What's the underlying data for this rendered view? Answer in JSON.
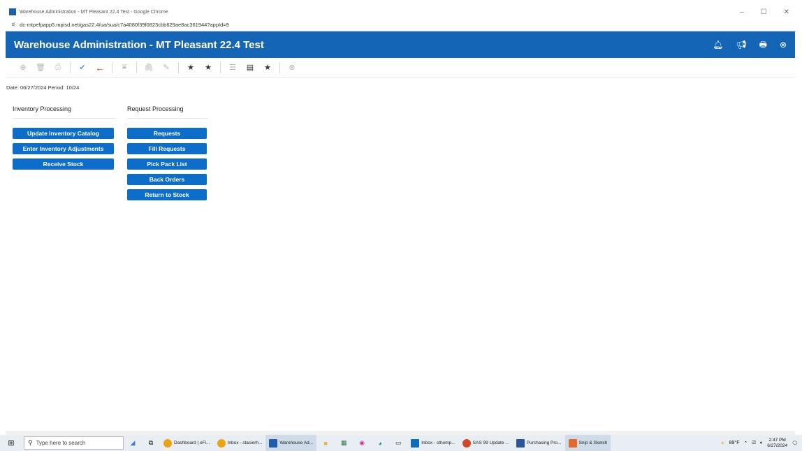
{
  "browser": {
    "window_title": "Warehouse Administration - MT Pleasant 22.4 Test - Google Chrome",
    "url": "dc-mtpefpapp5.mpisd.net/gas22.4/ua/sua/c7a4080f39f0823cbb629ae8ac361944?appId=9",
    "controls": [
      "–",
      "☐",
      "✕"
    ]
  },
  "header": {
    "title": "Warehouse Administration - MT Pleasant 22.4 Test"
  },
  "info": {
    "date_period": "Date: 06/27/2024 Period: 10/24"
  },
  "inventory": {
    "heading": "Inventory Processing",
    "buttons": [
      "Update Inventory Catalog",
      "Enter Inventory Adjustments",
      "Receive Stock"
    ]
  },
  "requests": {
    "heading": "Request Processing",
    "buttons": [
      "Requests",
      "Fill Requests",
      "Pick Pack List",
      "Back Orders",
      "Return to Stock"
    ]
  },
  "taskbar": {
    "search_placeholder": "Type here to search",
    "apps": [
      "Dashboard | eFi...",
      "Inbox - stacierh...",
      "Warehouse Ad...",
      "Inbox - sthomp...",
      "SAS 99 Update ...",
      "Purchasing Pro...",
      "Snip & Sketch"
    ],
    "temperature": "89°F",
    "time": "2:47 PM",
    "date": "6/27/2024"
  },
  "colors": {
    "header_blue": "#1565b7",
    "button_blue": "#0d6ec9"
  }
}
